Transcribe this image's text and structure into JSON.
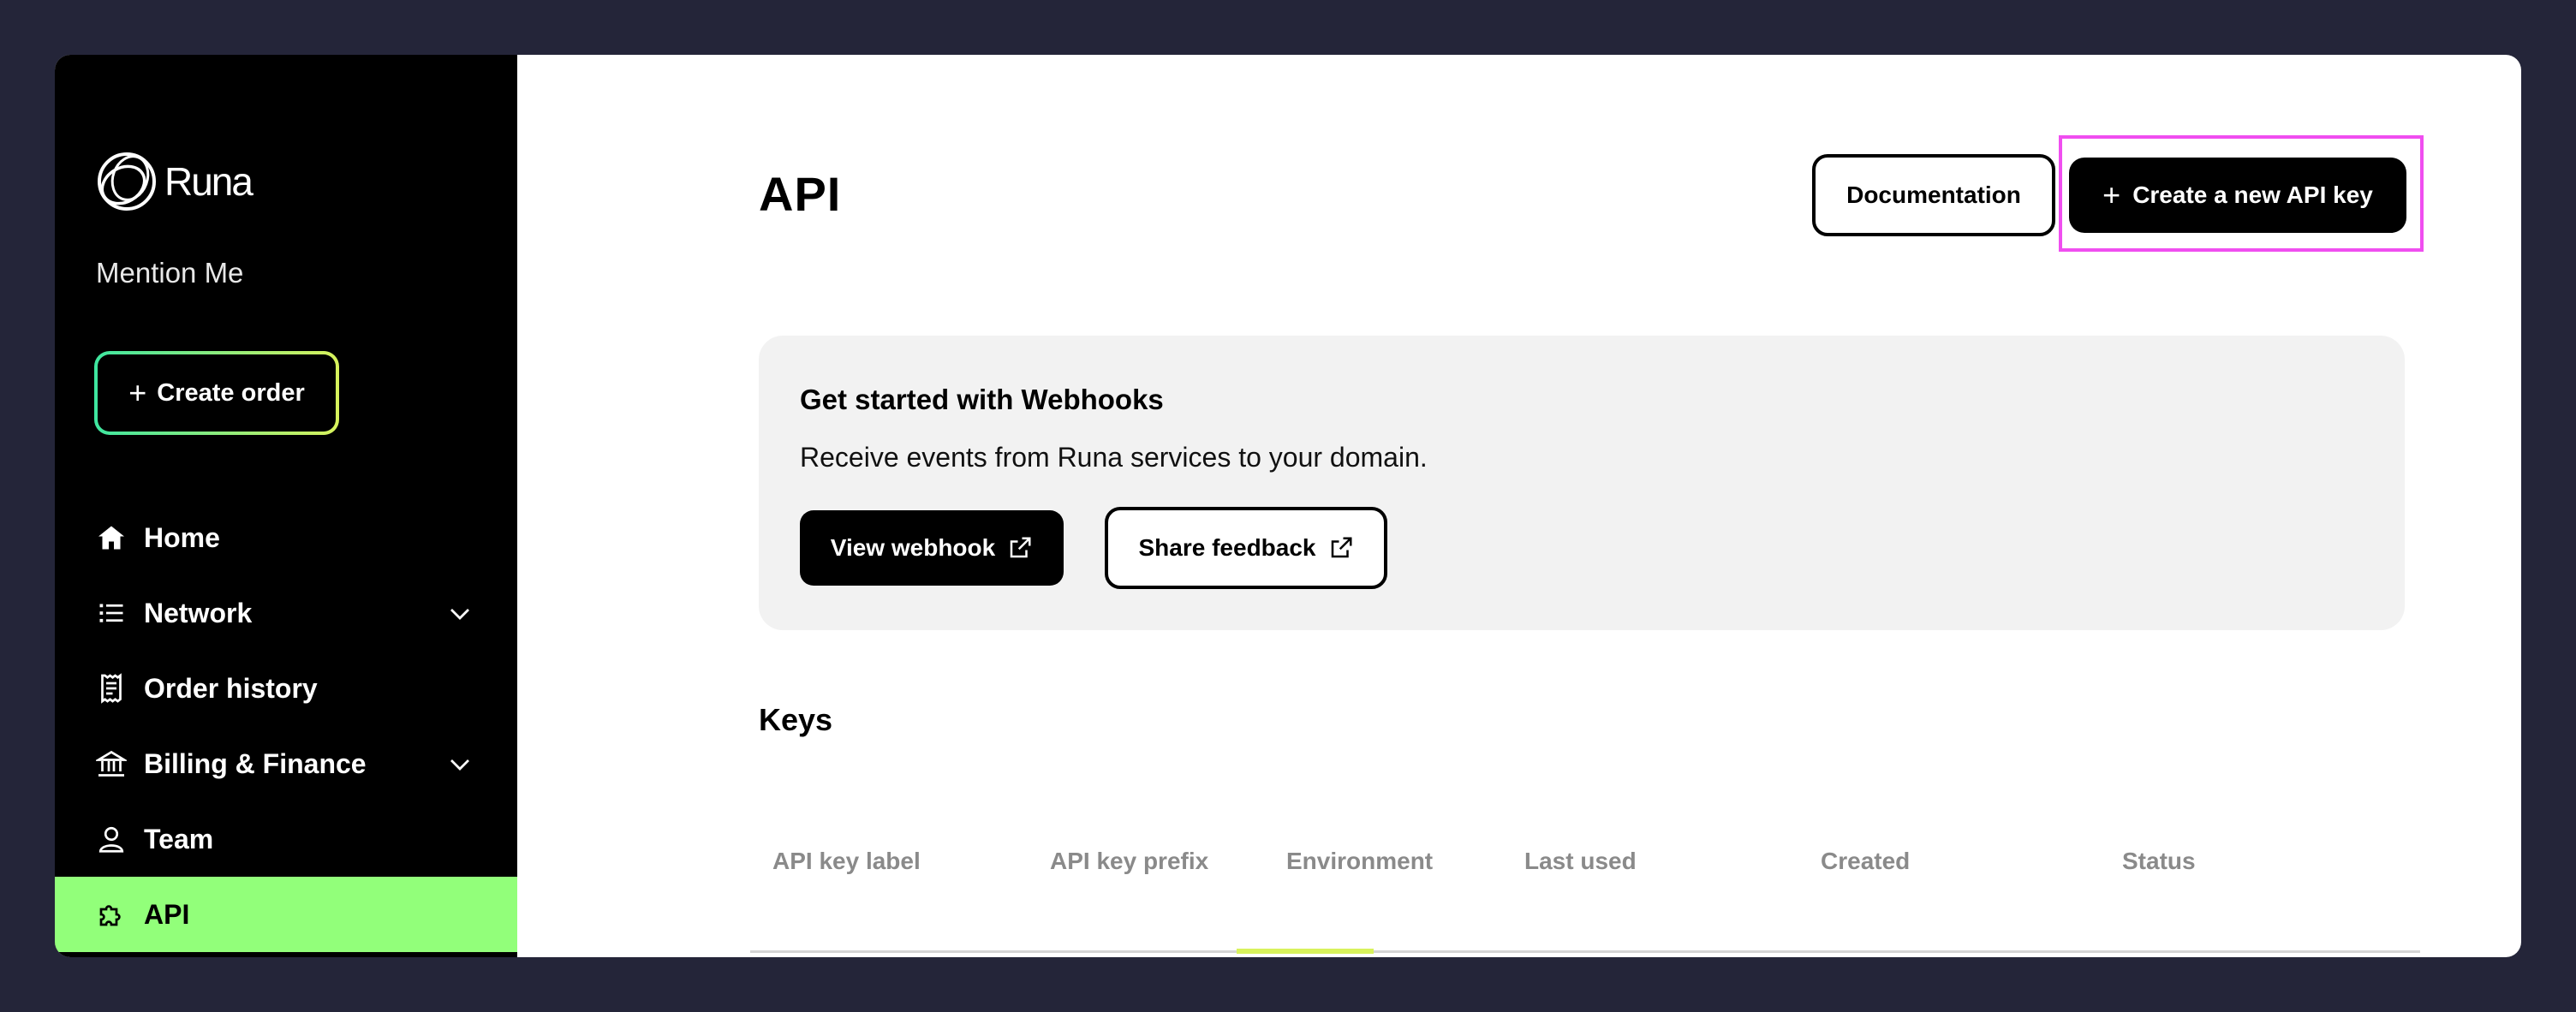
{
  "app": {
    "logo_text": "Runa",
    "organization": "Mention Me"
  },
  "sidebar": {
    "create_order_label": "Create order",
    "items": [
      {
        "label": "Home",
        "icon": "home-icon",
        "expandable": false,
        "active": false
      },
      {
        "label": "Network",
        "icon": "list-icon",
        "expandable": true,
        "active": false
      },
      {
        "label": "Order history",
        "icon": "receipt-icon",
        "expandable": false,
        "active": false
      },
      {
        "label": "Billing & Finance",
        "icon": "bank-icon",
        "expandable": true,
        "active": false
      },
      {
        "label": "Team",
        "icon": "user-icon",
        "expandable": false,
        "active": false
      },
      {
        "label": "API",
        "icon": "puzzle-icon",
        "expandable": false,
        "active": true
      }
    ],
    "active_color": "#92ff7a"
  },
  "header": {
    "title": "API",
    "documentation_label": "Documentation",
    "create_key_label": "Create a new API key",
    "highlight_color": "#f04ef0"
  },
  "webhooks": {
    "title": "Get started with Webhooks",
    "description": "Receive events from Runa services to your domain.",
    "view_label": "View webhook",
    "feedback_label": "Share feedback"
  },
  "keys": {
    "title": "Keys",
    "columns": [
      "API key label",
      "API key prefix",
      "Environment",
      "Last used",
      "Created",
      "Status"
    ]
  }
}
